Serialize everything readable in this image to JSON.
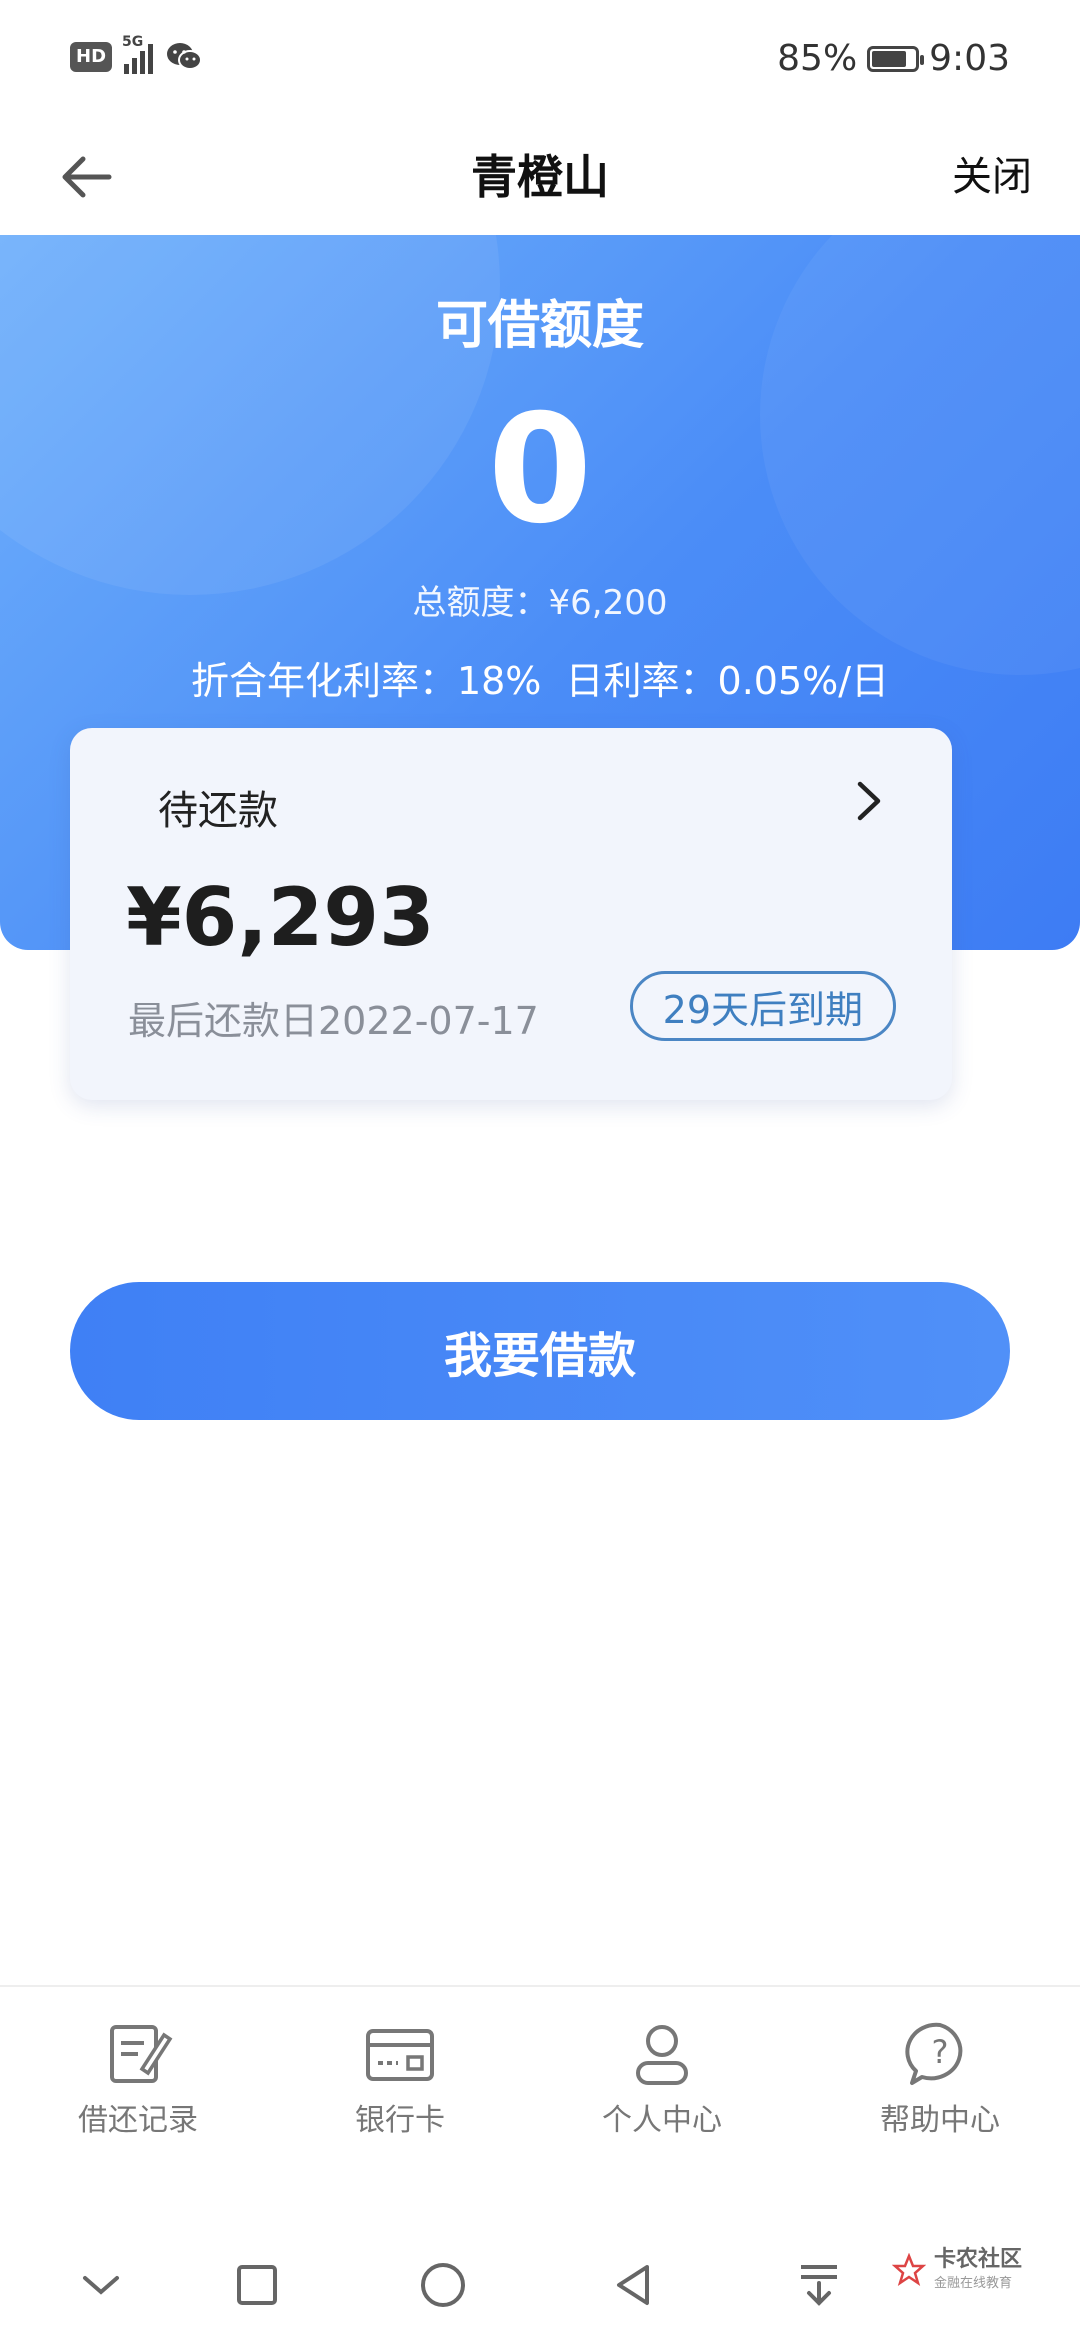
{
  "status_bar": {
    "hd": "HD",
    "network": "5G",
    "battery_percent": "85%",
    "battery_level": 0.85,
    "time": "9:03"
  },
  "nav": {
    "title": "青橙山",
    "close_label": "关闭",
    "back_icon": "arrow-left-icon"
  },
  "hero": {
    "title": "可借额度",
    "amount": "0",
    "total_label": "总额度：¥6,200",
    "annual_rate": "折合年化利率：18%",
    "daily_rate": "日利率：0.05%/日"
  },
  "repay_card": {
    "label": "待还款",
    "amount": "¥6,293",
    "last_date": "最后还款日2022-07-17",
    "due_badge": "29天后到期"
  },
  "borrow_button": "我要借款",
  "tabs": [
    {
      "label": "借还记录",
      "icon": "record-icon"
    },
    {
      "label": "银行卡",
      "icon": "bank-card-icon"
    },
    {
      "label": "个人中心",
      "icon": "user-icon"
    },
    {
      "label": "帮助中心",
      "icon": "help-icon"
    }
  ],
  "watermark": {
    "main": "卡农社区",
    "sub": "金融在线教育"
  },
  "colors": {
    "brand_blue": "#4b8df7",
    "badge_blue": "#3f7fc0"
  }
}
